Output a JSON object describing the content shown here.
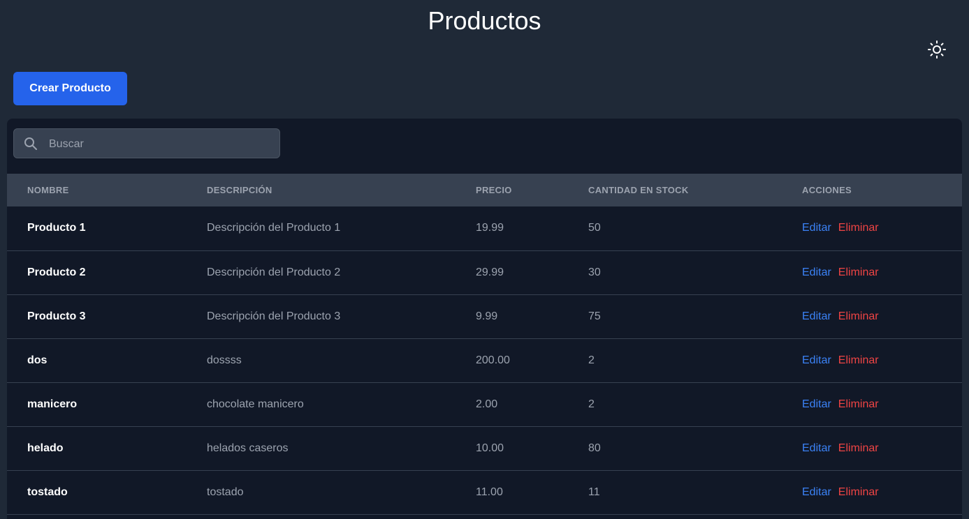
{
  "header": {
    "title": "Productos",
    "theme_icon": "sun-icon"
  },
  "toolbar": {
    "create_label": "Crear Producto",
    "accent_color": "#2563eb"
  },
  "search": {
    "placeholder": "Buscar",
    "value": "",
    "icon": "search-icon"
  },
  "table": {
    "columns": [
      "NOMBRE",
      "DESCRIPCIÓN",
      "PRECIO",
      "CANTIDAD EN STOCK",
      "ACCIONES"
    ],
    "rows": [
      {
        "name": "Producto 1",
        "description": "Descripción del Producto 1",
        "price": "19.99",
        "stock": "50"
      },
      {
        "name": "Producto 2",
        "description": "Descripción del Producto 2",
        "price": "29.99",
        "stock": "30"
      },
      {
        "name": "Producto 3",
        "description": "Descripción del Producto 3",
        "price": "9.99",
        "stock": "75"
      },
      {
        "name": "dos",
        "description": "dossss",
        "price": "200.00",
        "stock": "2"
      },
      {
        "name": "manicero",
        "description": "chocolate manicero",
        "price": "2.00",
        "stock": "2"
      },
      {
        "name": "helado",
        "description": "helados caseros",
        "price": "10.00",
        "stock": "80"
      },
      {
        "name": "tostado",
        "description": "tostado",
        "price": "11.00",
        "stock": "11"
      }
    ],
    "actions": {
      "edit_label": "Editar",
      "delete_label": "Eliminar",
      "edit_color": "#3b82f6",
      "delete_color": "#ef4444"
    }
  }
}
